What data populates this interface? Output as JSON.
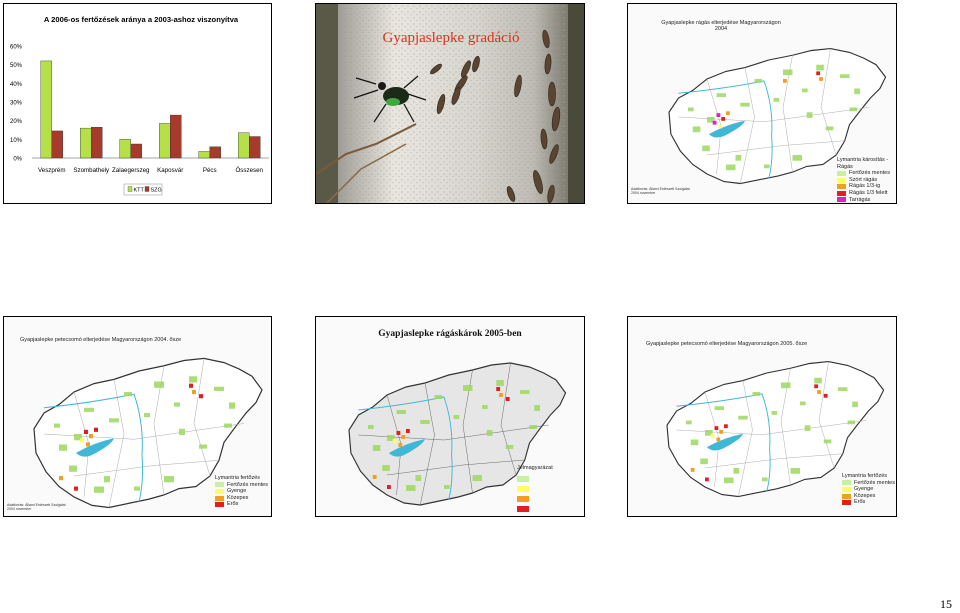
{
  "chart_data": {
    "type": "bar",
    "title": "A 2006-os fertőzések aránya a 2003-ashoz viszonyítva",
    "categories": [
      "Veszprém",
      "Szombathely",
      "Zalaegerszeg",
      "Kaposvár",
      "Pécs",
      "Összesen"
    ],
    "series": [
      {
        "name": "KTT",
        "values": [
          52,
          16,
          10,
          18.5,
          3.5,
          13.5
        ],
        "color": "#b5e04a"
      },
      {
        "name": "SZG",
        "values": [
          14.5,
          16.5,
          7.5,
          23,
          6,
          11.5
        ],
        "color": "#a83a2c"
      }
    ],
    "yticks": [
      "0%",
      "10%",
      "20%",
      "30%",
      "40%",
      "50%",
      "60%"
    ],
    "ylim": [
      0,
      60
    ],
    "legend_position": "bottom",
    "grid": false
  },
  "photo": {
    "title": "Gyapjaslepke gradáció"
  },
  "map_top_right": {
    "title_line1": "Gyapjaslepke rágás elterjedése Magyarországon",
    "title_line2": "2004",
    "legend_title": "Lymantria károsítás - Rágás",
    "legend_items": [
      {
        "label": "Fertőzés mentes",
        "color": "#c8f0a0"
      },
      {
        "label": "Szórt rágás",
        "color": "#ffff60"
      },
      {
        "label": "Rágás 1/3-ig",
        "color": "#f0a020"
      },
      {
        "label": "Rágás 1/3 felett",
        "color": "#e02020"
      },
      {
        "label": "Tarrágás",
        "color": "#e020c0"
      }
    ],
    "source_line1": "Adatforrás: Állami Erdészeti Szolgálat",
    "source_line2": "2004 november"
  },
  "map_bottom_left": {
    "title": "Gyapjaslepke petecsomó elterjedése Magyarországon 2004. ősze",
    "legend_title": "Lymantria fertőzés",
    "legend_items": [
      {
        "label": "Fertőzés mentes",
        "color": "#c8f0a0"
      },
      {
        "label": "Gyenge",
        "color": "#ffff60"
      },
      {
        "label": "Közepes",
        "color": "#f0a020"
      },
      {
        "label": "Erős",
        "color": "#e02020"
      }
    ],
    "source_line1": "Adatforrás: Állami Erdészeti Szolgálat",
    "source_line2": "2004 november"
  },
  "map_bottom_middle": {
    "title": "Gyapjaslepke rágáskárok 2005-ben",
    "legend_title": "Jelmagyarázat",
    "legend_items": [
      {
        "label": "",
        "color": "#c8f0a0"
      },
      {
        "label": "",
        "color": "#ffff60"
      },
      {
        "label": "",
        "color": "#f0a020"
      },
      {
        "label": "",
        "color": "#e02020"
      }
    ]
  },
  "map_bottom_right": {
    "title": "Gyapjaslepke petecsomó elterjedése Magyarországon 2005. ősze",
    "legend_title": "Lymantria fertőzés",
    "legend_items": [
      {
        "label": "Fertőzés mentes",
        "color": "#c8f0a0"
      },
      {
        "label": "Gyenge",
        "color": "#ffff60"
      },
      {
        "label": "Közepes",
        "color": "#f0a020"
      },
      {
        "label": "Erős",
        "color": "#e02020"
      }
    ]
  },
  "page_number": "15"
}
